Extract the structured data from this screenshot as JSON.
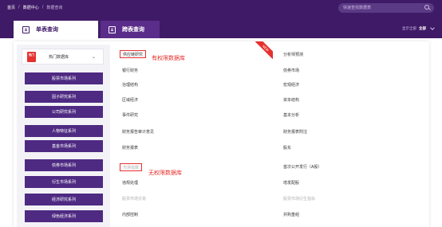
{
  "breadcrumb": {
    "home": "首页",
    "separator": "/",
    "data_center": "数据中心",
    "current": "数据查询"
  },
  "search": {
    "placeholder": "快速查找数据表",
    "icon": "search-icon"
  },
  "tabs": {
    "single": {
      "label": "单表查询",
      "icon": "table-icon"
    },
    "cross": {
      "label": "跨表查询",
      "icon": "table-icon"
    }
  },
  "display_mode": {
    "label": "显示全部",
    "value": "全部",
    "icon": "chevron-down-icon"
  },
  "sidebar": {
    "hot": {
      "badge": "热门",
      "label": "热门数据库",
      "icon": "chevron-down-icon"
    },
    "series": [
      "股票市场系列",
      "因子研究系列",
      "公司研究系列",
      "人物特征系列",
      "基金市场系列",
      "债券市场系列",
      "衍生市场系列",
      "经济研究系列",
      "绿色经济系列"
    ]
  },
  "ribbon": "NEW",
  "content": {
    "col1": [
      "供应链研究",
      "银行财务",
      "治理结构",
      "区域经济",
      "事件研究",
      "财务报告审计意见",
      "财务报表",
      "市场指数",
      "违规处理",
      "股票市场交易",
      "内部控制"
    ],
    "col2": [
      "分析师预测",
      "债券市场",
      "宏观经济",
      "资本结构",
      "基本分析",
      "财务报表附注",
      "股东",
      "首次公开发行（A股）",
      "增发配股",
      "股票市场衍生指标",
      "并购重组"
    ]
  },
  "annotations": {
    "has_permission": "有权限数据库",
    "no_permission": "无权限数据库"
  },
  "colors": {
    "header": "#3f1a66",
    "series_button": "#4e2a82",
    "accent_red": "#e5312e"
  }
}
